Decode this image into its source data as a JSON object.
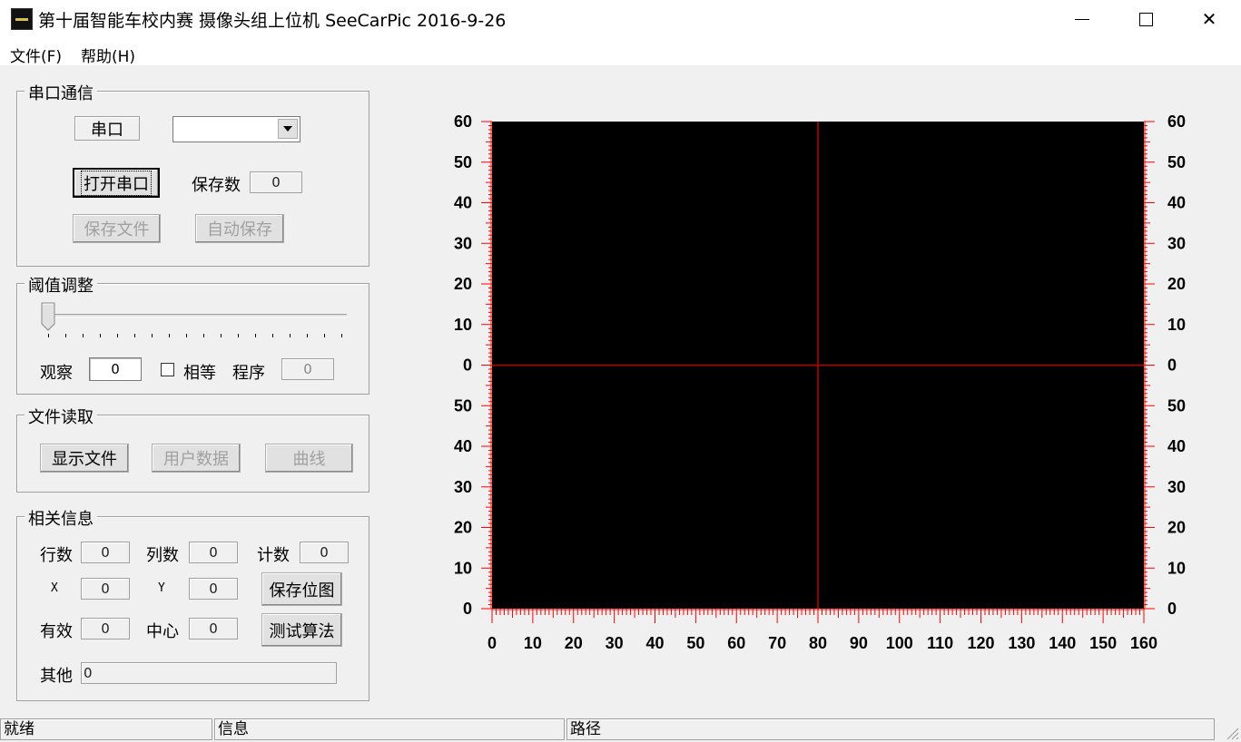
{
  "window": {
    "title": "第十届智能车校内赛 摄像头组上位机 SeeCarPic 2016-9-26",
    "minimize_label": "",
    "close_label": "✕"
  },
  "menu": [
    "文件(F)",
    "帮助(H)"
  ],
  "serial": {
    "group_title": "串口通信",
    "port_label": "串口",
    "port_value": "",
    "open_button": "打开串口",
    "save_count_label": "保存数",
    "save_count_value": "0",
    "save_file_button": "保存文件",
    "auto_save_button": "自动保存"
  },
  "threshold": {
    "group_title": "阈值调整",
    "slider_value": 0,
    "observe_label": "观察",
    "observe_value": "0",
    "equal_label": "相等",
    "equal_checked": false,
    "program_label": "程序",
    "program_value": "0"
  },
  "file_read": {
    "group_title": "文件读取",
    "show_file_button": "显示文件",
    "user_data_button": "用户数据",
    "curve_button": "曲线"
  },
  "info": {
    "group_title": "相关信息",
    "rows_label": "行数",
    "rows_value": "0",
    "cols_label": "列数",
    "cols_value": "0",
    "count_label": "计数",
    "count_value": "0",
    "x_label": "X",
    "x_value": "0",
    "y_label": "Y",
    "y_value": "0",
    "save_bitmap_button": "保存位图",
    "valid_label": "有效",
    "valid_value": "0",
    "center_label": "中心",
    "center_value": "0",
    "test_algo_button": "测试算法",
    "other_label": "其他",
    "other_value": "0"
  },
  "chart": {
    "y_labels": [
      "60",
      "50",
      "40",
      "30",
      "20",
      "10",
      "0",
      "50",
      "40",
      "30",
      "20",
      "10",
      "0"
    ],
    "x_labels": [
      "0",
      "10",
      "20",
      "30",
      "40",
      "50",
      "60",
      "70",
      "80",
      "90",
      "100",
      "110",
      "120",
      "130",
      "140",
      "150",
      "160"
    ],
    "x_range": [
      0,
      160
    ],
    "crosshair_x": 80,
    "crosshair_y": 0,
    "bg_color": "#000000",
    "axis_color": "#ff0000",
    "crosshair_color": "#c00000"
  },
  "status": [
    "就绪",
    "信息",
    "路径"
  ]
}
